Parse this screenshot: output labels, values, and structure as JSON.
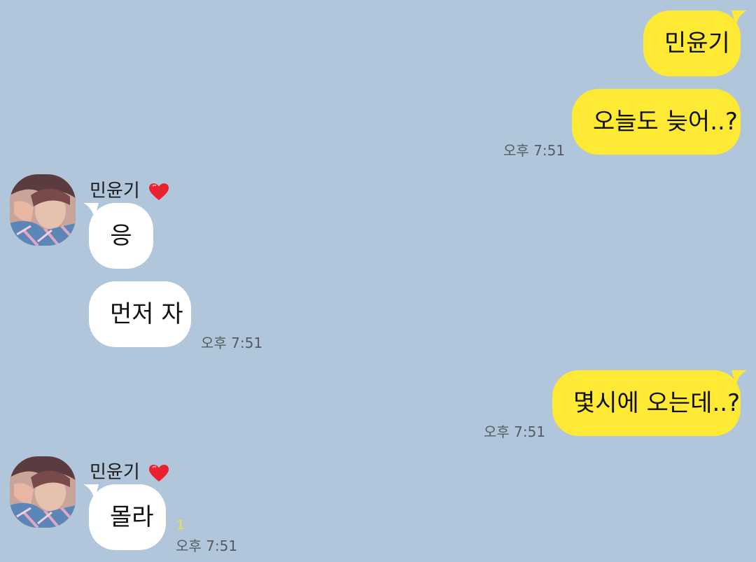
{
  "colors": {
    "background": "#b1c6da",
    "my_bubble": "#fee934",
    "their_bubble": "#ffffff",
    "timestamp": "#555b62",
    "unread": "#f5e13a",
    "heart": "#e8222f"
  },
  "messages": {
    "m1": {
      "text": "민윤기"
    },
    "m2": {
      "text": "오늘도 늦어..?",
      "time": "오후 7:51"
    },
    "group1": {
      "sender": "민윤기",
      "heart_icon": "heart-icon"
    },
    "m3": {
      "text": "응"
    },
    "m4": {
      "text": "먼저 자",
      "time": "오후 7:51"
    },
    "m5": {
      "text": "몇시에 오는데..?",
      "time": "오후 7:51"
    },
    "group2": {
      "sender": "민윤기",
      "heart_icon": "heart-icon"
    },
    "m6": {
      "text": "몰라",
      "time": "오후 7:51",
      "unread": "1"
    }
  }
}
